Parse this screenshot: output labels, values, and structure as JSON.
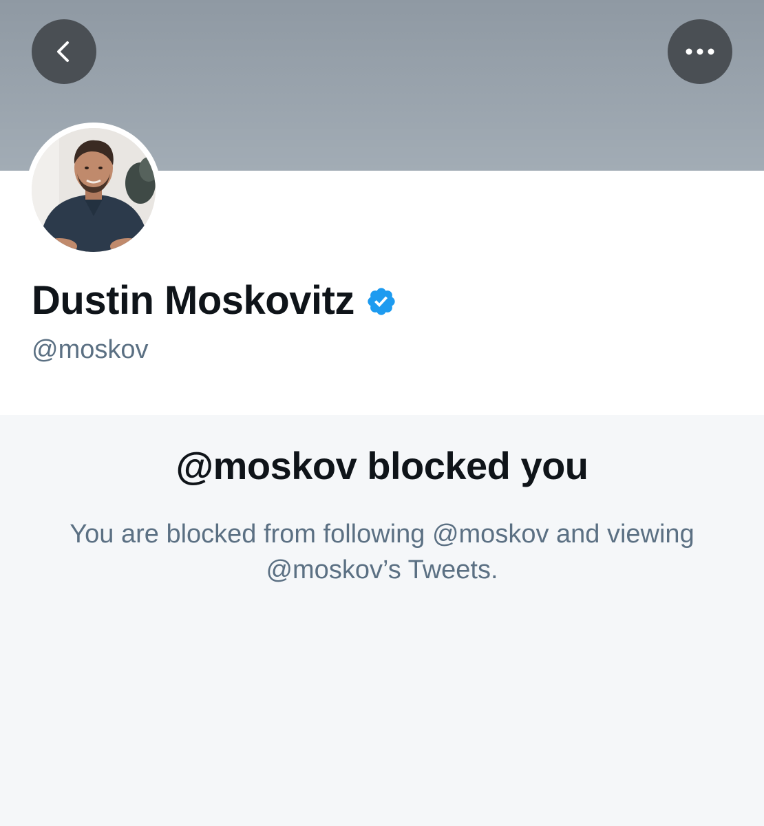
{
  "profile": {
    "display_name": "Dustin Moskovitz",
    "handle": "@moskov"
  },
  "header": {
    "back_icon": "chevron-left-icon",
    "more_icon": "ellipsis-icon"
  },
  "blocked": {
    "title": "@moskov blocked you",
    "description": "You are blocked from following @moskov and viewing @moskov’s Tweets."
  },
  "colors": {
    "verified_blue": "#1d9bf0",
    "secondary_text": "#5b7083",
    "primary_text": "#0f1419",
    "banner": "#98a2ac",
    "blocked_background": "#f5f7f9"
  }
}
